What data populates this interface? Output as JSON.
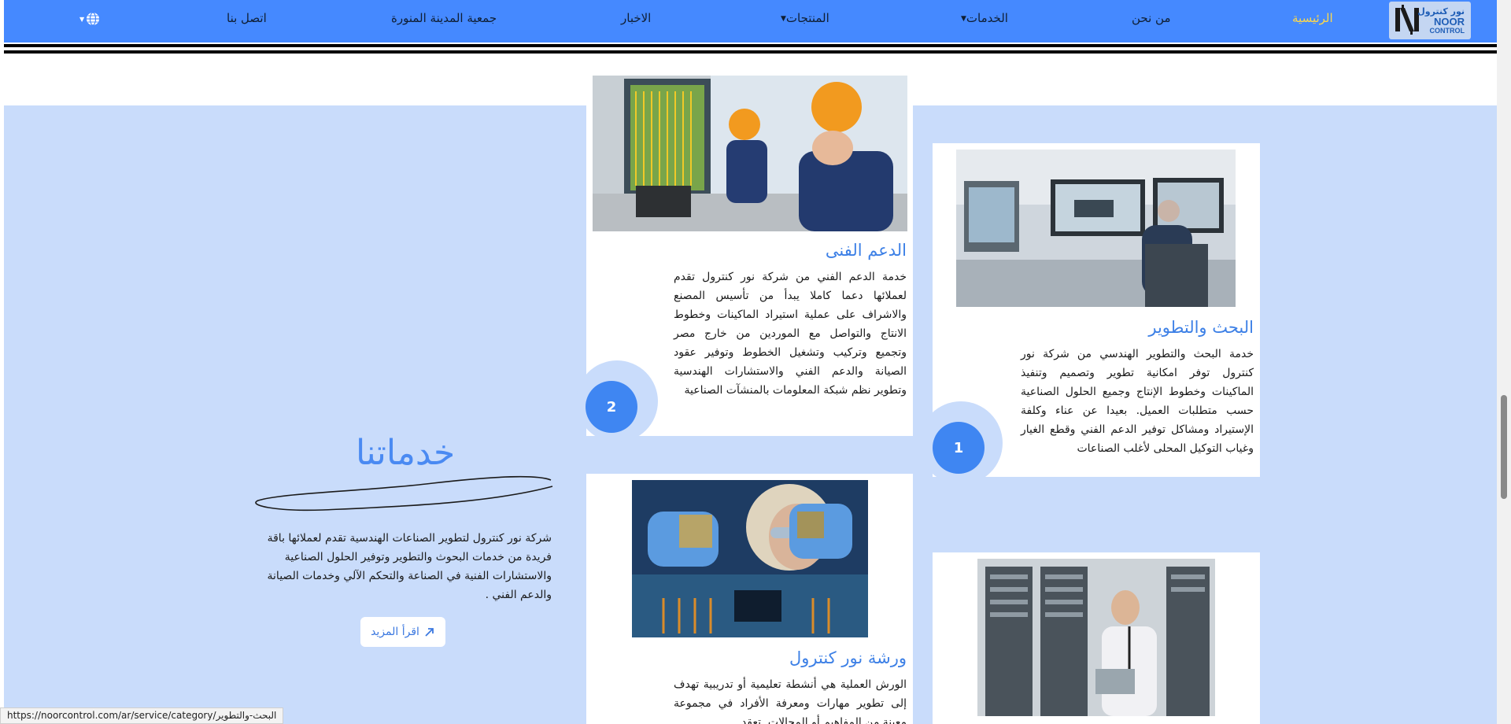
{
  "nav": {
    "logo": {
      "text_ar": "نور كنترول",
      "text_en": "NOOR",
      "text_en2": "CONTROL"
    },
    "items": [
      {
        "label": "الرئيسية",
        "active": true
      },
      {
        "label": "من نحن"
      },
      {
        "label": "الخدمات",
        "has_dropdown": true
      },
      {
        "label": "المنتجات",
        "has_dropdown": true
      },
      {
        "label": "الاخبار"
      },
      {
        "label": "جمعية المدينة المنورة"
      },
      {
        "label": "اتصل بنا"
      }
    ],
    "language_icon": "globe-icon"
  },
  "intro": {
    "title": "خدماتنا",
    "text": "شركة نور كنترول لتطوير الصناعات الهندسية تقدم لعملائها باقة فريدة من خدمات البحوث والتطوير وتوفير الحلول الصناعية والاستشارات الفنية في الصناعة والتحكم الآلي وخدمات الصيانة والدعم الفني .",
    "button_label": "اقرأ المزيد",
    "button_icon": "arrow-up-right-icon"
  },
  "services": [
    {
      "number": "1",
      "title": "البحث والتطوير",
      "text": "خدمة البحث والتطوير الهندسي من شركة نور كنترول توفر امكانية تطوير وتصميم وتنفيذ الماكينات وخطوط الإنتاج وجميع الحلول الصناعية حسب متطلبات العميل. بعيدا عن عناء وكلفة الإستيراد ومشاكل توفير الدعم الفني وقطع الغيار وغياب التوكيل المحلى لأغلب الصناعات",
      "image": "engineer-at-computer-workstation"
    },
    {
      "number": "2",
      "title": "الدعم الفنى",
      "text": "خدمة الدعم الفني من شركة نور كنترول تقدم لعملائها دعما كاملا يبدأ من تأسيس المصنع والاشراف على عملية استيراد الماكينات وخطوط الانتاج والتواصل مع الموردين من خارج مصر وتجميع وتركيب وتشغيل الخطوط وتوفير عقود الصيانة والدعم الفني والاستشارات الهندسية وتطوير نظم شبكة المعلومات بالمنشآت الصناعية",
      "image": "technicians-working-on-electrical-panel"
    },
    {
      "title": "ورشة نور كنترول",
      "text": "الورش العملية هي أنشطة تعليمية أو تدريبية تهدف إلى تطوير مهارات ومعرفة الأفراد في مجموعة معينة من المفاهيم أو المجالات. تعقد",
      "image": "engineer-inspecting-microchip"
    },
    {
      "image": "technician-in-server-room"
    }
  ],
  "status_bar": {
    "url": "https://noorcontrol.com/ar/service/category/البحث-والتطوير"
  },
  "colors": {
    "nav_bg": "#4589ff",
    "panel_bg": "#c9dcfb",
    "accent": "#3d80e6",
    "active_nav": "#ffd94a"
  }
}
